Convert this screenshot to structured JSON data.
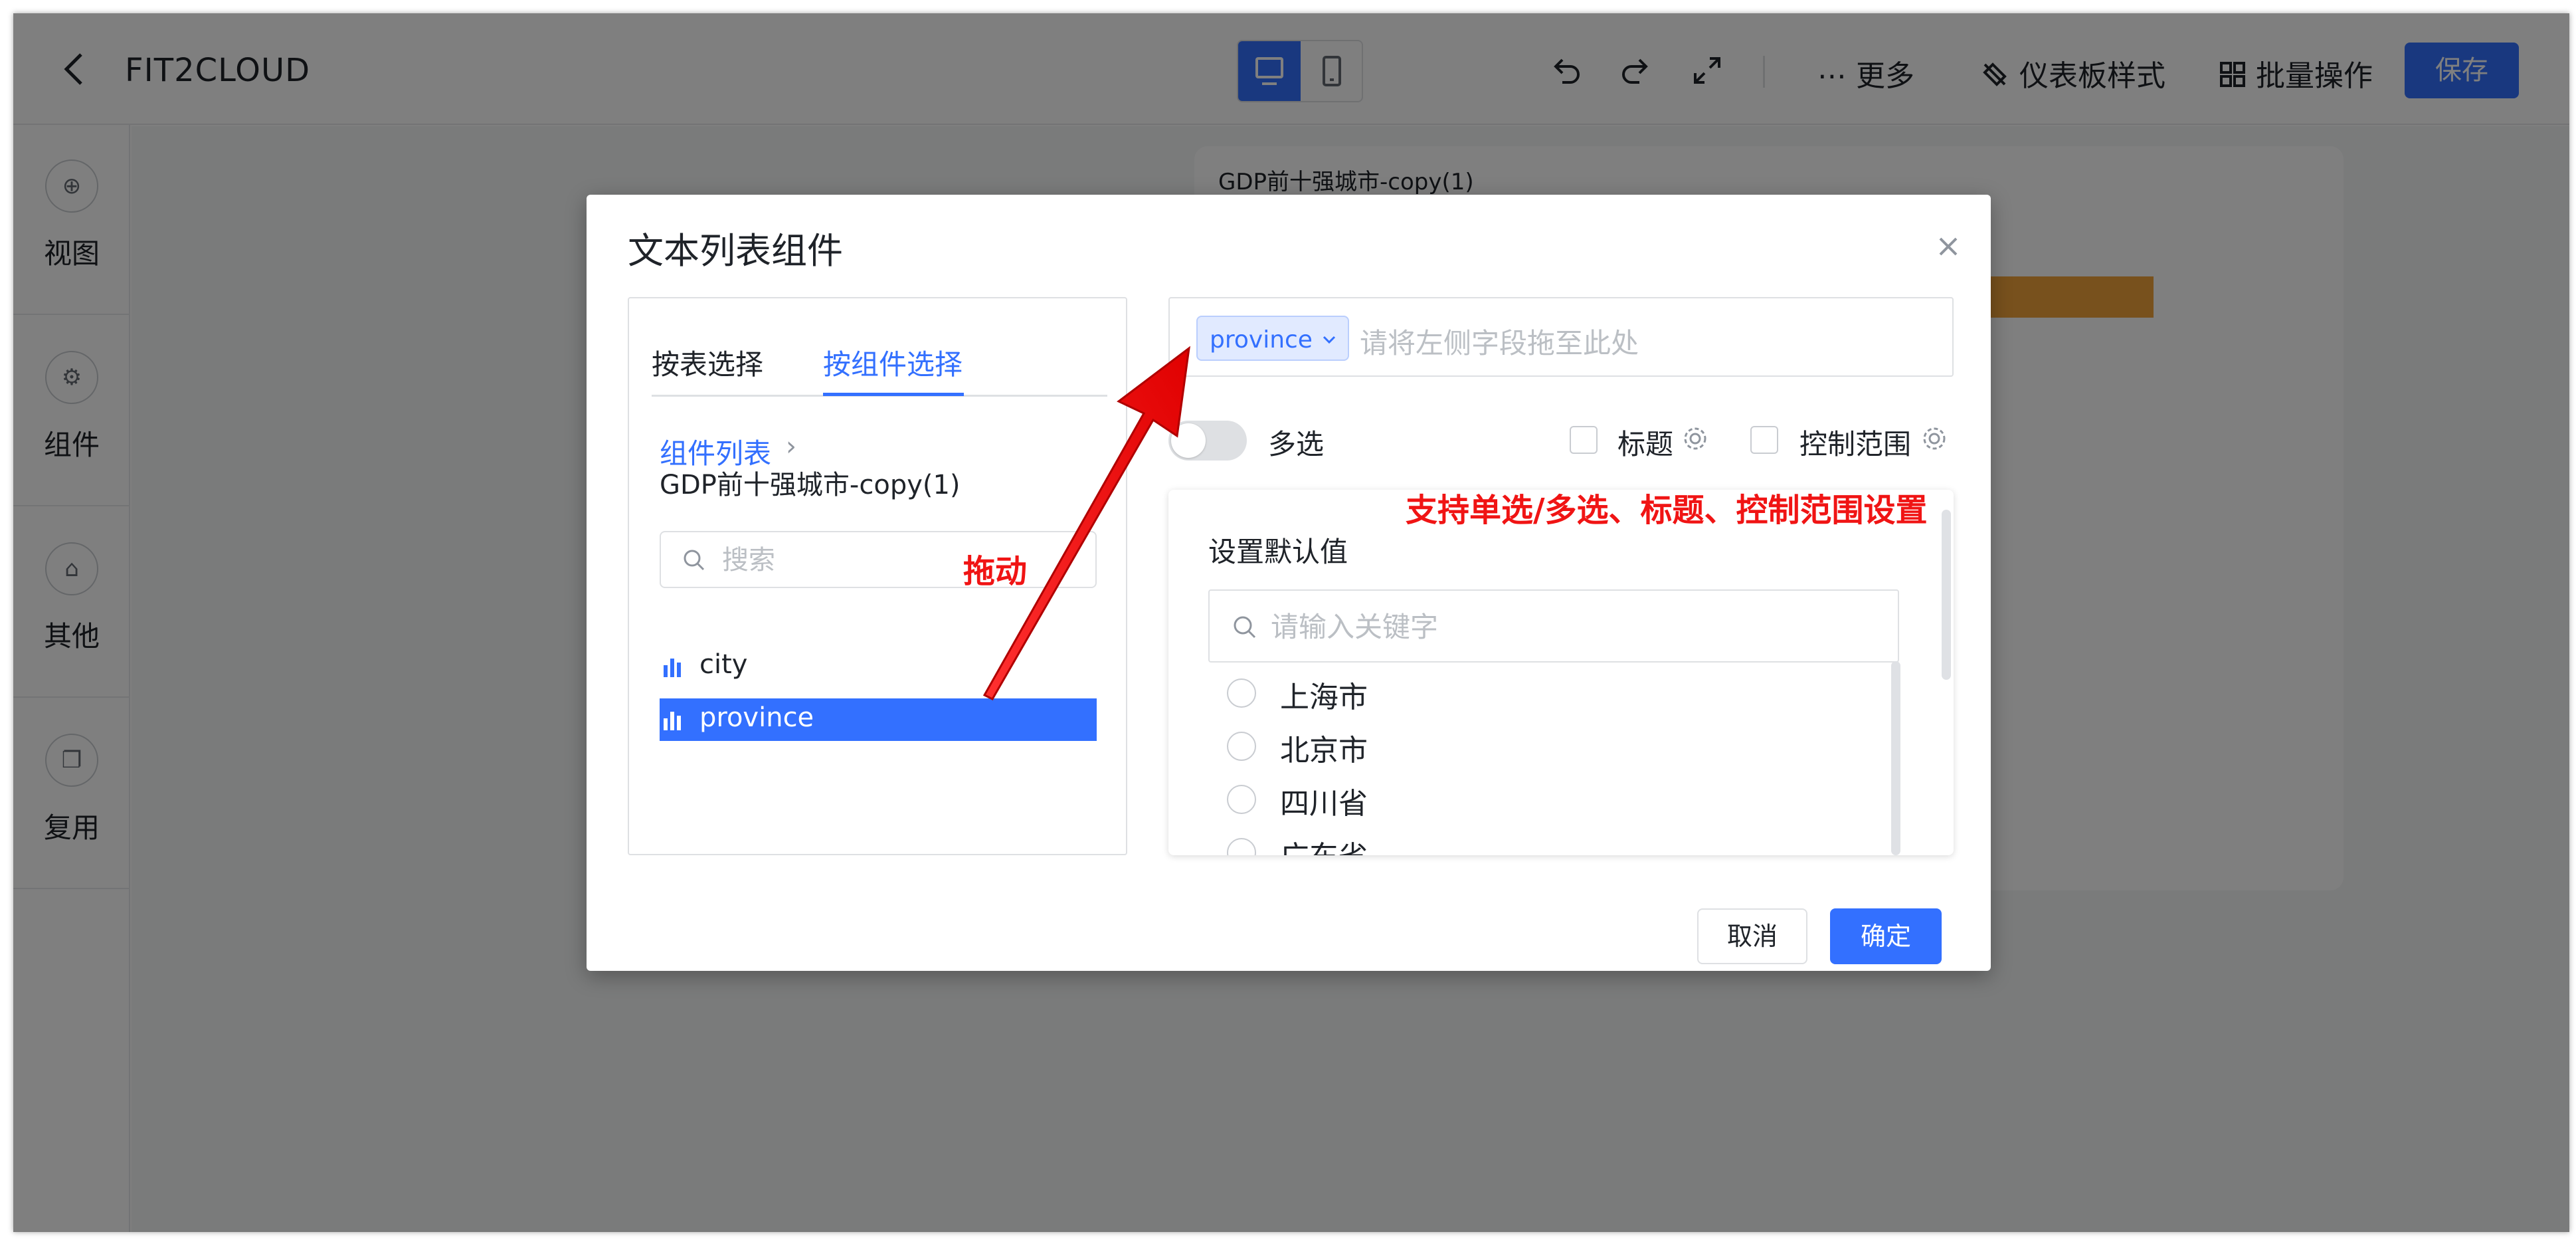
{
  "app": {
    "title": "FIT2CLOUD"
  },
  "toolbar": {
    "more": "⋯ 更多",
    "dashboard_style": "仪表板样式",
    "batch_ops": "批量操作",
    "save": "保存"
  },
  "sidebar": {
    "items": [
      {
        "label": "视图",
        "icon": "plus-circle-icon"
      },
      {
        "label": "组件",
        "icon": "gear-icon"
      },
      {
        "label": "其他",
        "icon": "stamp-icon"
      },
      {
        "label": "复用",
        "icon": "copy-icon"
      }
    ]
  },
  "background_card": {
    "title": "GDP前十强城市-copy(1)"
  },
  "dialog": {
    "title": "文本列表组件",
    "tabs": [
      "按表选择",
      "按组件选择"
    ],
    "breadcrumb": {
      "list": "组件列表",
      "current": "GDP前十强城市-copy(1)"
    },
    "search_placeholder": "搜索",
    "fields": [
      "city",
      "province"
    ],
    "selected_field": "province",
    "dropzone_hint": "请将左侧字段拖至此处",
    "multi_select": "多选",
    "title_option": "标题",
    "scope_option": "控制范围",
    "default_value": {
      "title": "设置默认值",
      "placeholder": "请输入关键字",
      "options": [
        "上海市",
        "北京市",
        "四川省",
        "广东省"
      ]
    },
    "cancel": "取消",
    "confirm": "确定"
  },
  "annotations": {
    "drag": "拖动",
    "support": "支持单选/多选、标题、控制范围设置",
    "color": "#f01414"
  },
  "colors": {
    "primary": "#3370ff",
    "chip_bg": "#e1eaff",
    "bar": "#f0a33a"
  }
}
